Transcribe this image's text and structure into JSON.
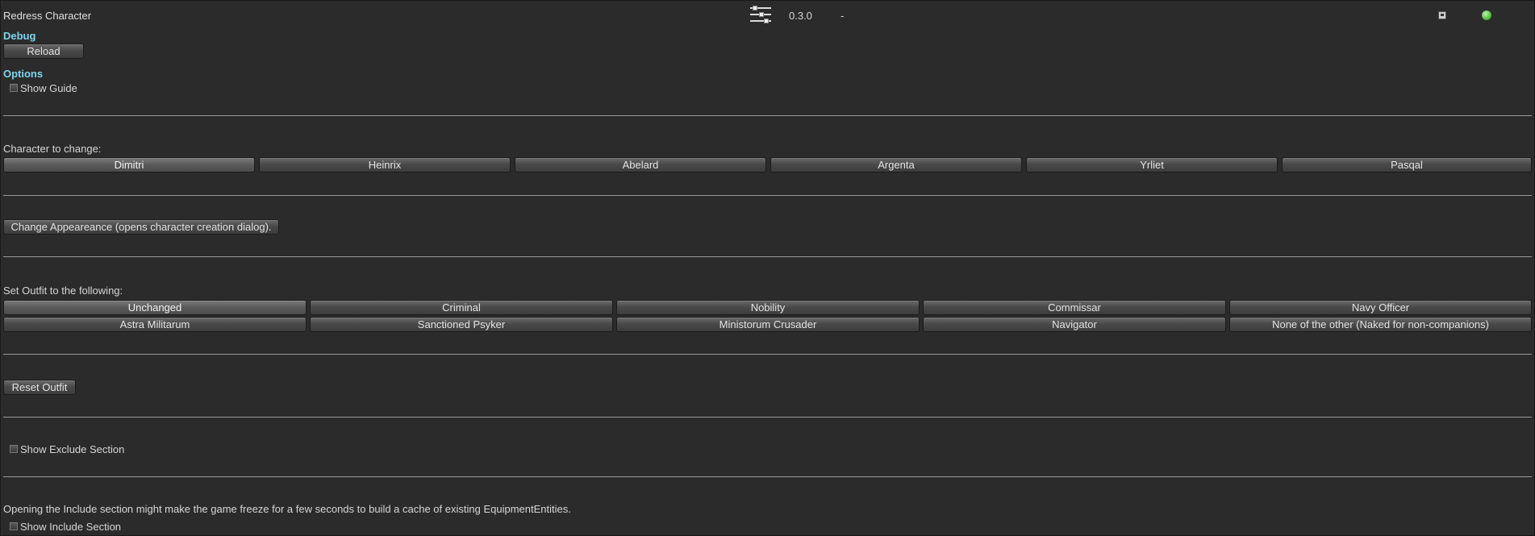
{
  "header": {
    "title": "Redress Character",
    "version": "0.3.0",
    "dash": "-",
    "status_color": "#5fc24a"
  },
  "debug": {
    "label": "Debug",
    "reload_label": "Reload"
  },
  "options": {
    "label": "Options",
    "show_guide_label": "Show Guide",
    "show_guide_checked": false
  },
  "character": {
    "prompt": "Character to change:",
    "options": [
      "Dimitri",
      "Heinrix",
      "Abelard",
      "Argenta",
      "Yrliet",
      "Pasqal"
    ],
    "selected": "Dimitri"
  },
  "appearance": {
    "change_label": "Change Appeareance (opens character creation dialog)."
  },
  "outfit": {
    "prompt": "Set Outfit to the following:",
    "options": [
      "Unchanged",
      "Criminal",
      "Nobility",
      "Commissar",
      "Navy Officer",
      "Astra Militarum",
      "Sanctioned Psyker",
      "Ministorum Crusader",
      "Navigator",
      "None of the other (Naked for non-companions)"
    ],
    "selected": "Unchanged",
    "reset_label": "Reset Outfit"
  },
  "exclude": {
    "label": "Show Exclude Section",
    "checked": false
  },
  "include": {
    "note": "Opening the Include section might make the game freeze for a few seconds to build a cache of existing EquipmentEntities.",
    "label": "Show Include Section",
    "checked": false
  },
  "icons": {
    "settings": "sliders-icon",
    "window": "window-icon",
    "status": "status-dot-icon"
  }
}
